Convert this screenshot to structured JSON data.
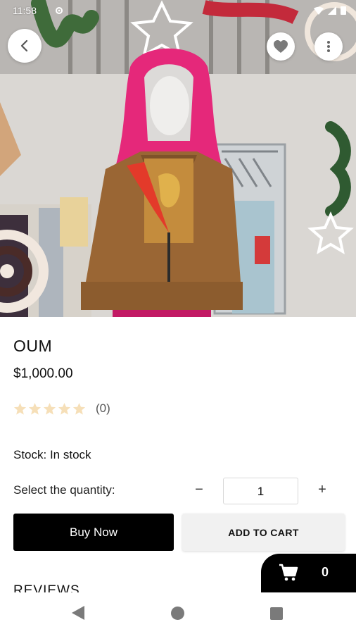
{
  "status_bar": {
    "time": "11:58"
  },
  "product": {
    "title": "OUM",
    "price": "$1,000.00",
    "rating_stars": 0,
    "rating_count": "(0)",
    "stock": "Stock: In stock"
  },
  "quantity": {
    "label": "Select the quantity:",
    "minus": "−",
    "value": "1",
    "plus": "+"
  },
  "actions": {
    "buy_now": "Buy Now",
    "add_to_cart": "ADD TO CART"
  },
  "reviews": {
    "heading": "REVIEWS"
  },
  "cart": {
    "count": "0"
  },
  "colors": {
    "primary": "#000000",
    "star_empty": "#f6dfb8",
    "secondary_button": "#f1f1f1"
  },
  "icons": [
    "back-arrow-icon",
    "heart-icon",
    "more-vert-icon",
    "star-icon",
    "cart-icon",
    "nav-back-icon",
    "nav-home-icon",
    "nav-recent-icon"
  ]
}
